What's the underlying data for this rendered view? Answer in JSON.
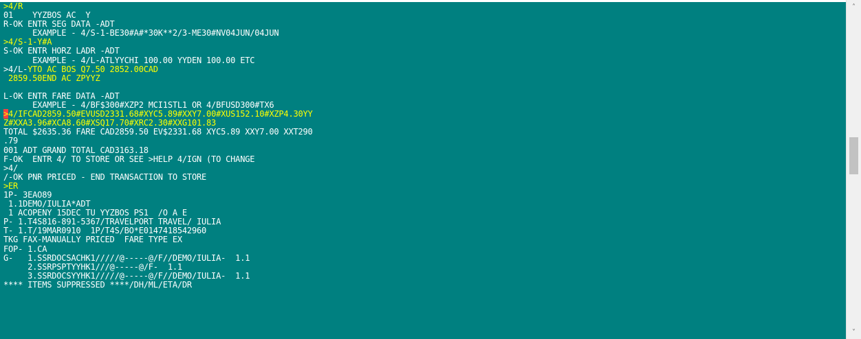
{
  "terminal": {
    "lines": [
      {
        "segments": [
          {
            "text": ">4/R",
            "color": "yellow"
          }
        ]
      },
      {
        "segments": [
          {
            "text": "01    YYZBOS AC  Y",
            "color": "white"
          }
        ]
      },
      {
        "segments": [
          {
            "text": "R-OK ENTR SEG DATA -ADT",
            "color": "white"
          }
        ]
      },
      {
        "segments": [
          {
            "text": "      EXAMPLE - 4/S-1-BE30#A#*30K**2/3-ME30#NV04JUN/04JUN",
            "color": "white"
          }
        ]
      },
      {
        "segments": [
          {
            "text": ">4/S-1-Y#A",
            "color": "yellow"
          }
        ]
      },
      {
        "segments": [
          {
            "text": "S-OK ENTR HORZ LADR -ADT",
            "color": "white"
          }
        ]
      },
      {
        "segments": [
          {
            "text": "      EXAMPLE - 4/L-ATLYYCHI 100.00 YYDEN 100.00 ETC",
            "color": "white"
          }
        ]
      },
      {
        "segments": [
          {
            "text": ">4/L-",
            "color": "white"
          },
          {
            "text": "YTO AC BOS Q7.50 2852.00CAD",
            "color": "yellow"
          }
        ]
      },
      {
        "segments": [
          {
            "text": " 2859.50END AC ZPYYZ",
            "color": "yellow"
          }
        ]
      },
      {
        "segments": [
          {
            "text": "",
            "color": "white"
          }
        ]
      },
      {
        "segments": [
          {
            "text": "L-OK ENTR FARE DATA -ADT",
            "color": "white"
          }
        ]
      },
      {
        "segments": [
          {
            "text": "      EXAMPLE - 4/BF$300#XZP2 MCI1STL1 OR 4/BFUSD300#TX6",
            "color": "white"
          }
        ]
      },
      {
        "segments": [
          {
            "text": ">",
            "color": "cursor"
          },
          {
            "text": "4/IFCAD2859.50#EVUSD2331.68#XYC5.89#XXY7.00#XUS152.10#XZP4.30YY",
            "color": "yellow"
          }
        ]
      },
      {
        "segments": [
          {
            "text": "Z#XXA3.96#XCA8.60#XSQ17.70#XRC2.30#XXG101.83",
            "color": "yellow"
          }
        ]
      },
      {
        "segments": [
          {
            "text": "TOTAL $2635.36 FARE CAD2859.50 EV$2331.68 XYC5.89 XXY7.00 XXT290",
            "color": "white"
          }
        ]
      },
      {
        "segments": [
          {
            "text": ".79",
            "color": "white"
          }
        ]
      },
      {
        "segments": [
          {
            "text": "001 ADT GRAND TOTAL CAD3163.18",
            "color": "white"
          }
        ]
      },
      {
        "segments": [
          {
            "text": "F-OK  ENTR 4/ TO STORE OR SEE >HELP 4/IGN (TO CHANGE",
            "color": "white"
          }
        ]
      },
      {
        "segments": [
          {
            "text": ">4/",
            "color": "white"
          }
        ]
      },
      {
        "segments": [
          {
            "text": "/-OK PNR PRICED - END TRANSACTION TO STORE",
            "color": "white"
          }
        ]
      },
      {
        "segments": [
          {
            "text": ">ER",
            "color": "yellow"
          }
        ]
      },
      {
        "segments": [
          {
            "text": "1P- 3EAO89",
            "color": "white"
          }
        ]
      },
      {
        "segments": [
          {
            "text": " 1.1DEMO/IULIA*ADT",
            "color": "white"
          }
        ]
      },
      {
        "segments": [
          {
            "text": " 1 ACOPENY 15DEC TU YYZBOS PS1  /O A E",
            "color": "white"
          }
        ]
      },
      {
        "segments": [
          {
            "text": "P- 1.T4S816-891-5367/TRAVELPORT TRAVEL/ IULIA",
            "color": "white"
          }
        ]
      },
      {
        "segments": [
          {
            "text": "T- 1.T/19MAR0910  1P/T4S/BO*E0147418542960",
            "color": "white"
          }
        ]
      },
      {
        "segments": [
          {
            "text": "TKG FAX-MANUALLY PRICED  FARE TYPE EX",
            "color": "white"
          }
        ]
      },
      {
        "segments": [
          {
            "text": "FOP- 1.CA",
            "color": "white"
          }
        ]
      },
      {
        "segments": [
          {
            "text": "G-   1.SSRDOCSACHK1/////@-----@/F//DEMO/IULIA-  1.1",
            "color": "white"
          }
        ]
      },
      {
        "segments": [
          {
            "text": "     2.SSRPSPTYYHK1///@-----@/F-  1.1",
            "color": "white"
          }
        ]
      },
      {
        "segments": [
          {
            "text": "     3.SSRDOCSYYHK1/////@-----@/F//DEMO/IULIA-  1.1",
            "color": "white"
          }
        ]
      },
      {
        "segments": [
          {
            "text": "**** ITEMS SUPPRESSED ****/DH/ML/ETA/DR",
            "color": "white"
          }
        ]
      }
    ]
  },
  "scrollbar": {
    "up_icon": "˄",
    "down_icon": "˅",
    "position_fraction": 0.45
  },
  "colors": {
    "background": "#008080",
    "text": "#ffffff",
    "input": "#ffff00",
    "cursor": "#ff4040"
  }
}
